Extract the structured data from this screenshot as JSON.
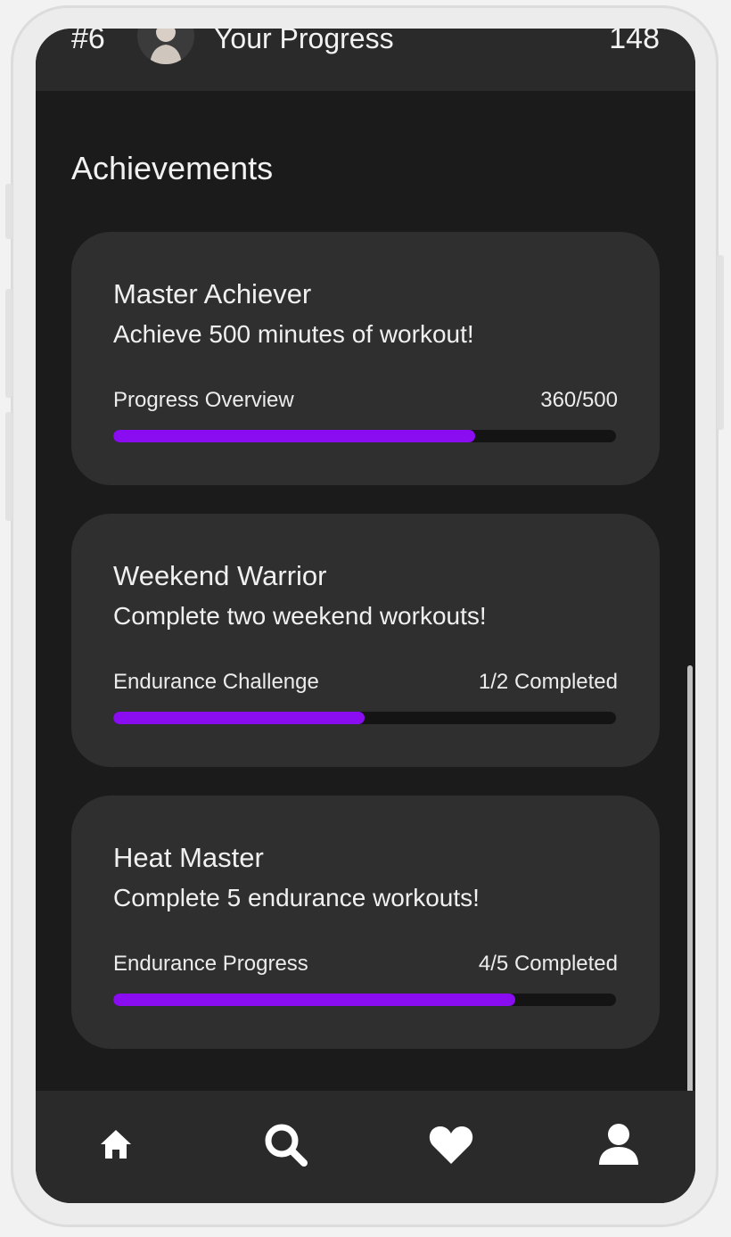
{
  "header": {
    "rank": "#6",
    "title": "Your Progress",
    "score": "148"
  },
  "section_title": "Achievements",
  "achievements": [
    {
      "title": "Master Achiever",
      "description": "Achieve 500 minutes of workout!",
      "label": "Progress Overview",
      "value": "360/500",
      "progress": 0.72
    },
    {
      "title": "Weekend Warrior",
      "description": "Complete two weekend workouts!",
      "label": "Endurance Challenge",
      "value": "1/2 Completed",
      "progress": 0.5
    },
    {
      "title": "Heat Master",
      "description": "Complete 5 endurance workouts!",
      "label": "Endurance Progress",
      "value": "4/5 Completed",
      "progress": 0.8
    }
  ],
  "nav": {
    "items": [
      "home-icon",
      "search-icon",
      "heart-icon",
      "user-icon"
    ]
  },
  "colors": {
    "accent": "#8a0cf0",
    "background": "#1b1b1b",
    "card": "#2f2f2f",
    "bars": "#2a2a2a"
  }
}
